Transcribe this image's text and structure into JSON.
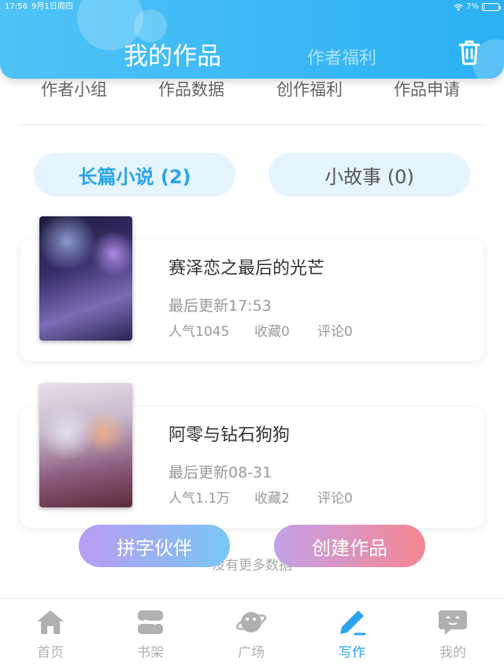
{
  "status_bar": {
    "time": "17:56",
    "date": "9月1日周四",
    "battery": "7%",
    "battery_level": 0.07
  },
  "header": {
    "tab_main": "我的作品",
    "tab_welfare": "作者福利",
    "accent": "#2bb0f3"
  },
  "sub_tabs": [
    "作者小组",
    "作品数据",
    "创作福利",
    "作品申请"
  ],
  "segments": {
    "long_novel": "长篇小说 (2)",
    "short_story": "小故事 (0)"
  },
  "works": [
    {
      "title": "赛泽恋之最后的光芒",
      "updated": "最后更新17:53",
      "popularity": "人气1045",
      "favorites": "收藏0",
      "comments": "评论0"
    },
    {
      "title": "阿零与钻石狗狗",
      "updated": "最后更新08-31",
      "popularity": "人气1.1万",
      "favorites": "收藏2",
      "comments": "评论0"
    }
  ],
  "buttons": {
    "pinzi": "拼字伙伴",
    "create": "创建作品"
  },
  "no_more": "没有更多数据",
  "nav": {
    "home": "首页",
    "shelf": "书架",
    "plaza": "广场",
    "write": "写作",
    "mine": "我的"
  }
}
